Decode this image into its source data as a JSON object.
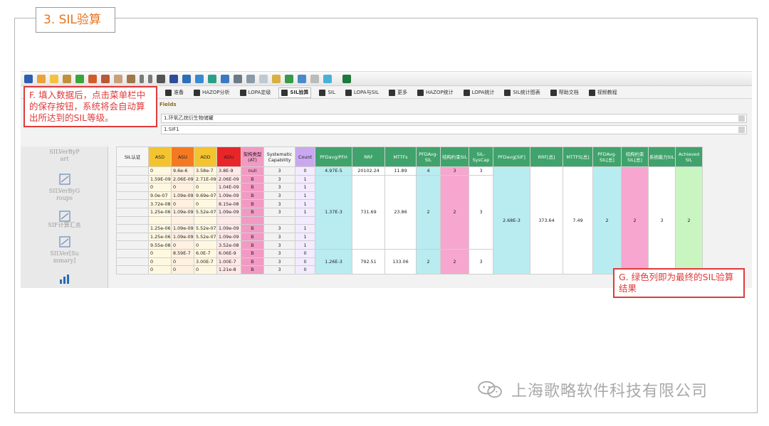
{
  "section_title": "3. SIL验算",
  "colors": {
    "orange_title": "#e8731e",
    "callout_red": "#e03a3a",
    "asd": "#f4c430",
    "asu": "#f47920",
    "add": "#f4c430",
    "adu": "#e8262a",
    "arch": "#f29ac4",
    "count": "#c9a8f0",
    "pfd": "#b8ecf0",
    "green_header": "#3fa36b",
    "sil_pink": "#f7a6cf",
    "achieved": "#c8f5c0"
  },
  "toolbar_tabs": [
    {
      "label": "准备",
      "active": false
    },
    {
      "label": "HAZOP分析",
      "active": false
    },
    {
      "label": "LOPA定级",
      "active": false
    },
    {
      "label": "SIL验算",
      "active": true
    },
    {
      "label": "SIL",
      "active": false
    },
    {
      "label": "LOPA与SIL",
      "active": false
    },
    {
      "label": "更多",
      "active": false
    },
    {
      "label": "HAZOP统计",
      "active": false
    },
    {
      "label": "LOPA统计",
      "active": false
    },
    {
      "label": "SIL统计图表",
      "active": false
    },
    {
      "label": "帮助文档",
      "active": false
    },
    {
      "label": "视频教程",
      "active": false
    }
  ],
  "fields": {
    "label": "Fields",
    "field1": "1.环氧乙烷衍生物储罐",
    "field2": "1.SIF1"
  },
  "sidebar": [
    {
      "label": "SILVerByP\nart",
      "icon": "grid-icon"
    },
    {
      "label": "SILVerByG\nroups",
      "icon": "edit-icon"
    },
    {
      "label": "SIF计算汇总",
      "icon": "clock-doc-icon"
    },
    {
      "label": "SILVer[Su\nmmary]",
      "icon": "calculator-icon"
    },
    {
      "label": "",
      "icon": "bar-chart-icon"
    }
  ],
  "table": {
    "headers": [
      "SIL认证",
      "ASD",
      "ASU",
      "ADD",
      "ADU",
      "架构类型(AT)",
      "Systematic Capability",
      "Count",
      "PFDavg/PFH",
      "RRF",
      "MTTFs",
      "PFDAvg-SIL",
      "结构约束SIL",
      "SIL-SysCap",
      "PFDavg[SIF]",
      "RRF[总]",
      "MTTFS[总]",
      "PFDAvg-SIL[总]",
      "结构约束SIL[总]",
      "系统能力SIL",
      "Achieved SIL"
    ],
    "rows": [
      [
        "",
        "0",
        "9.6e-6",
        "3.58e-7",
        "3.8E-9",
        "null",
        "3",
        "0"
      ],
      [
        "",
        "1.59E-09",
        "2.06E-09",
        "2.71E-09",
        "2.06E-09",
        "B",
        "3",
        "1"
      ],
      [
        "",
        "0",
        "0",
        "0",
        "1.04E-09",
        "B",
        "3",
        "1"
      ],
      [
        "",
        "9.0e-07",
        "1.09e-09",
        "9.69e-07",
        "1.09e-09",
        "B",
        "3",
        "1"
      ],
      [
        "",
        "3.72e-08",
        "0",
        "0",
        "8.15e-08",
        "B",
        "3",
        "1"
      ],
      [
        "",
        "1.25e-06",
        "1.09e-09",
        "5.52e-07",
        "1.09e-09",
        "B",
        "3",
        "1"
      ],
      [
        "",
        "",
        "",
        "",
        "",
        "",
        "",
        ""
      ],
      [
        "",
        "1.25e-06",
        "1.09e-09",
        "5.52e-07",
        "1.09e-09",
        "B",
        "3",
        "1"
      ],
      [
        "",
        "1.25e-06",
        "1.09e-09",
        "5.52e-07",
        "1.09e-09",
        "B",
        "3",
        "1"
      ],
      [
        "",
        "9.55e-08",
        "0",
        "0",
        "3.52e-08",
        "B",
        "3",
        "1"
      ],
      [
        "",
        "0",
        "8.59E-7",
        "6.0E-7",
        "6.06E-9",
        "B",
        "3",
        "0"
      ],
      [
        "",
        "0",
        "0",
        "3.00E-7",
        "1.00E-7",
        "B",
        "3",
        "0"
      ],
      [
        "",
        "0",
        "0",
        "0",
        "1.21e-8",
        "B",
        "3",
        "0"
      ]
    ],
    "group_values": [
      {
        "pfd": "4.97E-5",
        "rrf": "20102.24",
        "mttfs": "11.89",
        "pfdsil": "4",
        "struct": "3",
        "syscap": "3"
      },
      {
        "pfd": "1.37E-3",
        "rrf": "731.69",
        "mttfs": "23.86",
        "pfdsil": "2",
        "struct": "2",
        "syscap": "3"
      },
      {
        "pfd": "1.26E-3",
        "rrf": "792.51",
        "mttfs": "133.06",
        "pfdsil": "2",
        "struct": "2",
        "syscap": "3"
      }
    ],
    "total": {
      "pfd": "2.68E-3",
      "rrf": "373.64",
      "mttfs": "7.49",
      "pfdsil": "2",
      "struct": "2",
      "syscap": "3",
      "achieved": "2"
    }
  },
  "callout_f": "F. 填入数据后，点击菜单栏中的保存按钮，系统将会自动算出所达到的SIL等级。",
  "callout_g": "G. 绿色列即为最终的SIL验算结果",
  "watermark": "上海歌略软件科技有限公司"
}
